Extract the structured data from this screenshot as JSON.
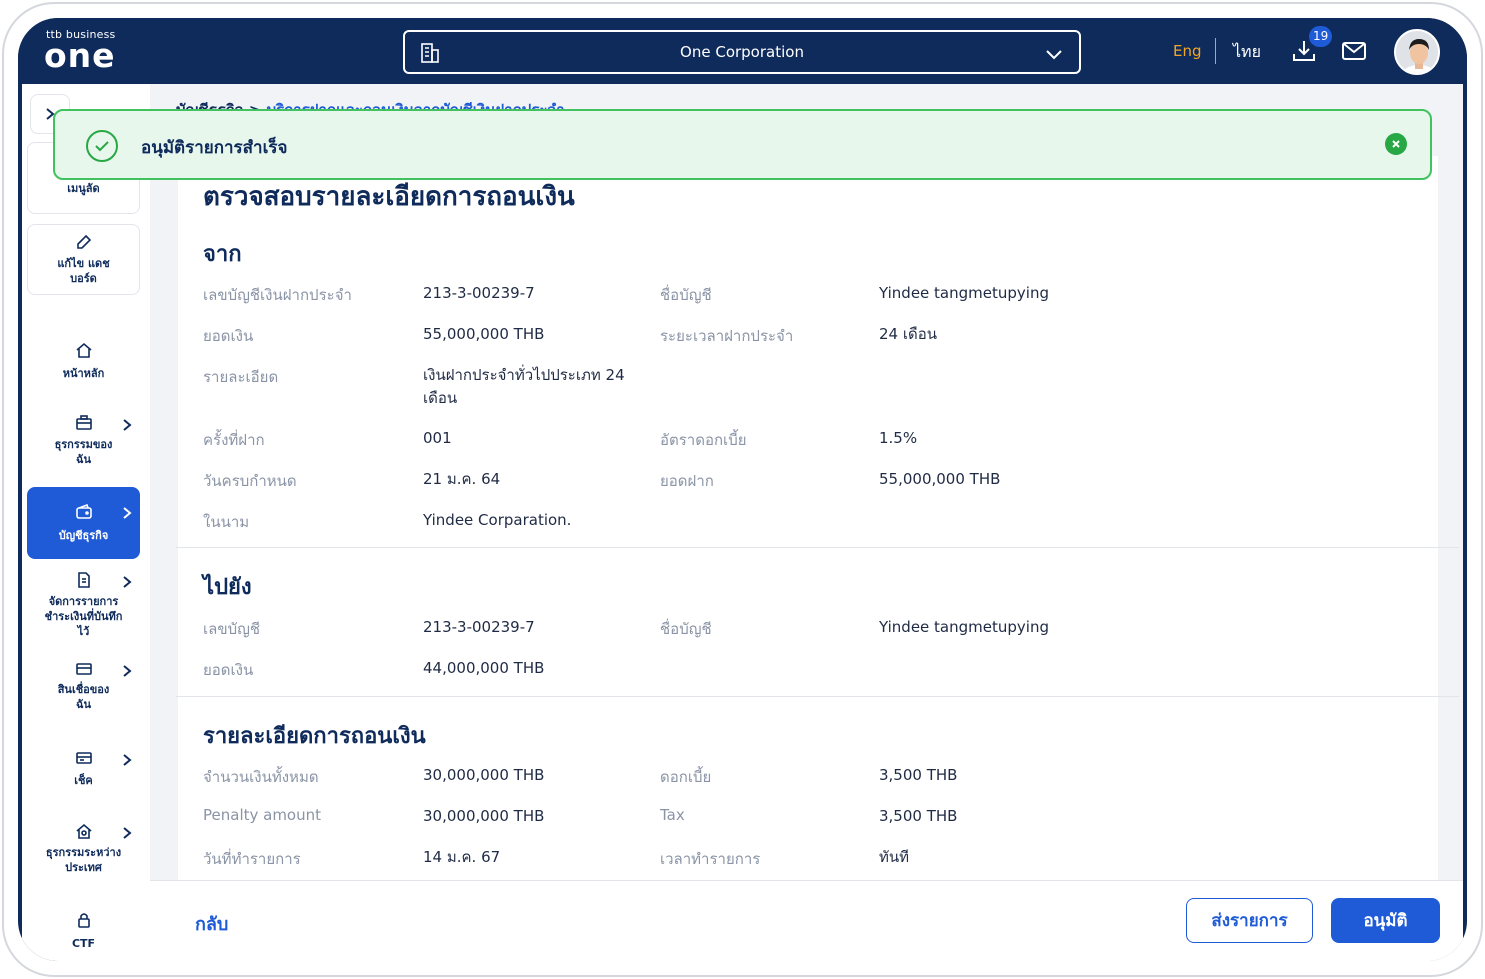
{
  "header": {
    "logo_small": "ttb business",
    "logo_big": "one",
    "company": "One Corporation",
    "lang_eng": "Eng",
    "lang_thai": "ไทย",
    "download_badge": "19"
  },
  "sidebar": {
    "items": [
      {
        "label": "เมนูลัด"
      },
      {
        "label": "แก้ไข แดชบอร์ด"
      },
      {
        "label": "หน้าหลัก"
      },
      {
        "label": "ธุรกรรมของฉัน"
      },
      {
        "label": "บัญชีธุรกิจ"
      },
      {
        "label": "จัดการรายการชำระเงินที่บันทึกไว้"
      },
      {
        "label": "สินเชื่อของฉัน"
      },
      {
        "label": "เช็ค"
      },
      {
        "label": "ธุรกรรมระหว่างประเทศ"
      },
      {
        "label": "CTF"
      }
    ]
  },
  "breadcrumb": {
    "root": "บัญชีธุรกิจ",
    "sep": ">",
    "current": "บริการฝากและถอนเงินจากบัญชีเงินฝากประจำ"
  },
  "toast": {
    "message": "อนุมัติรายการสำเร็จ"
  },
  "card": {
    "title": "ตรวจสอบรายละเอียดการถอนเงิน",
    "from": {
      "title": "จาก",
      "rows": [
        {
          "label": "เลขบัญชีเงินฝากประจำ",
          "value": "213-3-00239-7"
        },
        {
          "label": "ชื่อบัญชี",
          "value": "Yindee tangmetupying"
        },
        {
          "label": "ยอดเงิน",
          "value": "55,000,000 THB"
        },
        {
          "label": "ระยะเวลาฝากประจำ",
          "value": "24 เดือน"
        },
        {
          "label": "รายละเอียด",
          "value": "เงินฝากประจำทั่วไปประเภท 24 เดือน"
        },
        {
          "label": "ครั้งที่ฝาก",
          "value": "001"
        },
        {
          "label": "อัตราดอกเบี้ย",
          "value": "1.5%"
        },
        {
          "label": "วันครบกำหนด",
          "value": "21 ม.ค. 64"
        },
        {
          "label": "ยอดฝาก",
          "value": "55,000,000 THB"
        },
        {
          "label": "ในนาม",
          "value": "Yindee Corparation."
        }
      ]
    },
    "to": {
      "title": "ไปยัง",
      "rows": [
        {
          "label": "เลขบัญชี",
          "value": "213-3-00239-7"
        },
        {
          "label": "ชื่อบัญชี",
          "value": "Yindee tangmetupying"
        },
        {
          "label": "ยอดเงิน",
          "value": "44,000,000 THB"
        }
      ]
    },
    "withdraw": {
      "title": "รายละเอียดการถอนเงิน",
      "rows": [
        {
          "label": "จำนวนเงินทั้งหมด",
          "value": "30,000,000 THB"
        },
        {
          "label": "ดอกเบี้ย",
          "value": "3,500 THB"
        },
        {
          "label": "Penalty amount",
          "value": "30,000,000 THB"
        },
        {
          "label": "Tax",
          "value": "3,500 THB"
        },
        {
          "label": "วันที่ทำรายการ",
          "value": "14 ม.ค. 67"
        },
        {
          "label": "เวลาทำรายการ",
          "value": "ทันที"
        }
      ]
    }
  },
  "footer": {
    "back": "กลับ",
    "send": "ส่งรายการ",
    "approve": "อนุมัติ"
  },
  "colors": {
    "navy": "#0f2b5b",
    "accent": "#1f5bd6",
    "eng": "#f5a623",
    "success": "#41c25e"
  }
}
